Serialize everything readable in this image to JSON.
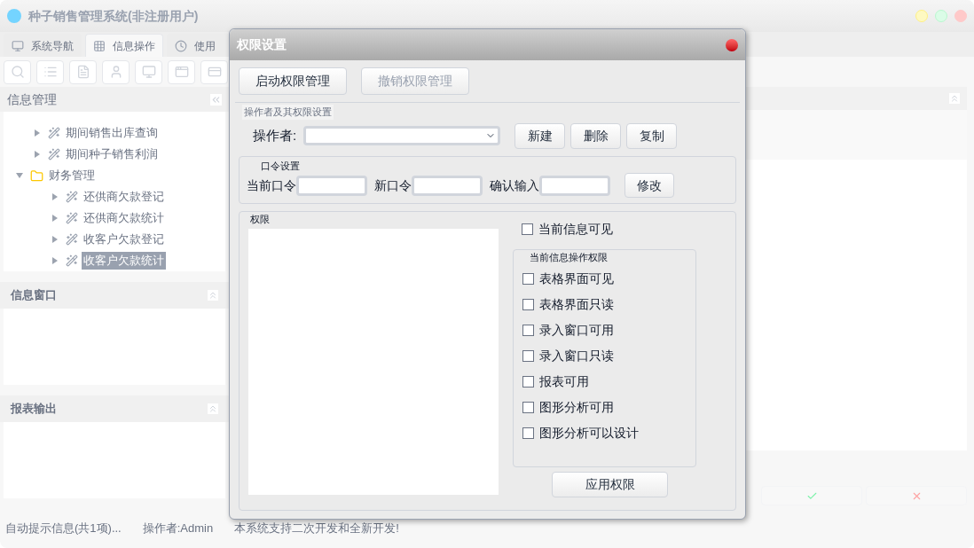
{
  "window": {
    "title": "种子销售管理系统(非注册用户)"
  },
  "tabs": [
    {
      "label": "系统导航",
      "selected": false,
      "kind": "monitor"
    },
    {
      "label": "信息操作",
      "selected": true,
      "kind": "grid"
    },
    {
      "label": "使用",
      "selected": false,
      "kind": "clock"
    }
  ],
  "toolbar": [
    {
      "kind": "search"
    },
    {
      "kind": "list"
    },
    {
      "kind": "document"
    },
    {
      "kind": "person"
    },
    {
      "kind": "monitor"
    },
    {
      "kind": "add-window"
    },
    {
      "kind": "card"
    }
  ],
  "info_panel": {
    "title": "信息管理",
    "tree": [
      {
        "label": "期间销售出库查询",
        "kind": "leaf",
        "expanded": false,
        "selected": false
      },
      {
        "label": "期间种子销售利润",
        "kind": "leaf",
        "expanded": false,
        "selected": false
      },
      {
        "label": "财务管理",
        "kind": "folder",
        "expanded": true,
        "selected": false,
        "children": [
          {
            "label": "还供商欠款登记",
            "kind": "leaf",
            "expanded": false,
            "selected": false
          },
          {
            "label": "还供商欠款统计",
            "kind": "leaf",
            "expanded": false,
            "selected": false
          },
          {
            "label": "收客户欠款登记",
            "kind": "leaf",
            "expanded": false,
            "selected": false
          },
          {
            "label": "收客户欠款统计",
            "kind": "leaf",
            "expanded": false,
            "selected": true
          }
        ]
      }
    ]
  },
  "side_panels": [
    {
      "title": "信息窗口"
    },
    {
      "title": "报表输出"
    }
  ],
  "status_bar": [
    "自动提示信息(共1项)...",
    "操作者:Admin",
    "本系统支持二次开发和全新开发!"
  ],
  "dialog": {
    "title": "权限设置",
    "top_buttons": [
      {
        "label": "启动权限管理",
        "disabled": false
      },
      {
        "label": "撤销权限管理",
        "disabled": true
      }
    ],
    "operator_group": {
      "title": "操作者及其权限设置",
      "label": "操作者:",
      "buttons": [
        "新建",
        "删除",
        "复制"
      ]
    },
    "password_group": {
      "title": "口令设置",
      "fields": [
        "当前口令",
        "新口令",
        "确认输入"
      ],
      "button": "修改"
    },
    "permission_group": {
      "title": "权限",
      "visible_checkbox": {
        "label": "当前信息可见",
        "checked": false
      },
      "ops_title": "当前信息操作权限",
      "ops": [
        {
          "label": "表格界面可见",
          "checked": false
        },
        {
          "label": "表格界面只读",
          "checked": false
        },
        {
          "label": "录入窗口可用",
          "checked": false
        },
        {
          "label": "录入窗口只读",
          "checked": false
        },
        {
          "label": "报表可用",
          "checked": false
        },
        {
          "label": "图形分析可用",
          "checked": false
        },
        {
          "label": "图形分析可以设计",
          "checked": false
        }
      ],
      "apply_button": "应用权限"
    }
  }
}
